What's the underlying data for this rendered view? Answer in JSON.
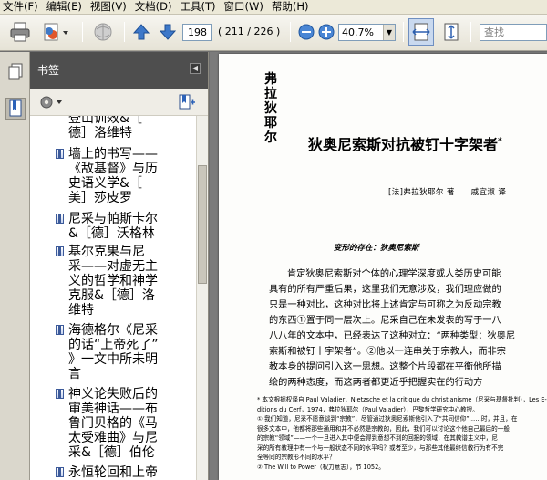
{
  "menu": [
    "文件(F)",
    "编辑(E)",
    "视图(V)",
    "文档(D)",
    "工具(T)",
    "窗口(W)",
    "帮助(H)"
  ],
  "toolbar": {
    "page_number": "198",
    "page_count": "( 211 / 226 )",
    "zoom": "40.7%",
    "search_placeholder": "查找"
  },
  "bookmarks": {
    "title": "书签",
    "items": [
      {
        "text": "登山训效&［\n德］洛维特",
        "partial": true
      },
      {
        "text": "墙上的书写——\n《敌基督》与历\n史语义学&［\n美］莎皮罗"
      },
      {
        "text": "尼采与帕斯卡尔\n&［德］沃格林"
      },
      {
        "text": "基尔克果与尼\n采——对虚无主\n义的哲学和神学\n克服&［德］洛\n维特"
      },
      {
        "text": "海德格尔《尼采\n的话“上帝死了”\n》一文中所未明\n言"
      },
      {
        "text": "神义论失败后的\n审美神话——布\n鲁门贝格的《马\n太受难曲》与尼\n采&［德］伯伦"
      },
      {
        "text": "永恒轮回和上帝\n已［美］阿久",
        "partial": true
      }
    ]
  },
  "document": {
    "vertical_author": [
      "弗",
      "拉",
      "狄",
      "耶",
      "尔"
    ],
    "title": "狄奥尼索斯对抗被钉十字架者",
    "title_mark": "*",
    "byline": "[法]弗拉狄耶尔 著　　戚宜淑 译",
    "subhead": "变形的存在：狄奥尼索斯",
    "body": [
      "肯定狄奥尼索斯对个体的心理学深度或人类历史可能",
      "具有的所有严重后果，这里我们无意涉及，我们理应做的",
      "只是一种对比，这种对比将上述肯定与可称之为反动宗教",
      "的东西①置于同一层次上。尼采自己在未发表的写于一八",
      "八八年的文本中，已经表达了这种对立：“两种类型：狄奥尼",
      "索斯和被钉十字架者”。②他以一连串关于宗教人，而非宗",
      "教本身的提问引入这一思想。这整个片段都在平衡他所描",
      "绘的两种态度，而这两者都更近乎把握实在的行动方"
    ],
    "footnotes": [
      "* 本文根据权译自 Paul Valadier，Nietzsche et la critique du christianisme（尼采与基督批判），Les E-",
      "ditions du Cerf，1974，弗拉狄耶尔（Paul Valadier），巴黎哲学研究中心教授。",
      "① 我们知道，尼采不愿意谈到“宗教”，尽管通过狄奥尼索斯他引入了“共同信仰”……时，并且，在",
      "很多文本中，他都将那些通用和并不必然是宗教的，因此，我们可以讨论这个他自己最后的一般",
      "的宗教“领域”——一个一旦进入其中便会得到意想不到的回报的领域，在其教谱主义中，尼",
      "采的所有教理中有一个与一般状态不同的水平吗？或者至少，与那些其他最终信教行为有不完",
      "全等同的宗教形不同的水平？",
      "② The Will to Power（权力意志），节 1052。"
    ]
  }
}
